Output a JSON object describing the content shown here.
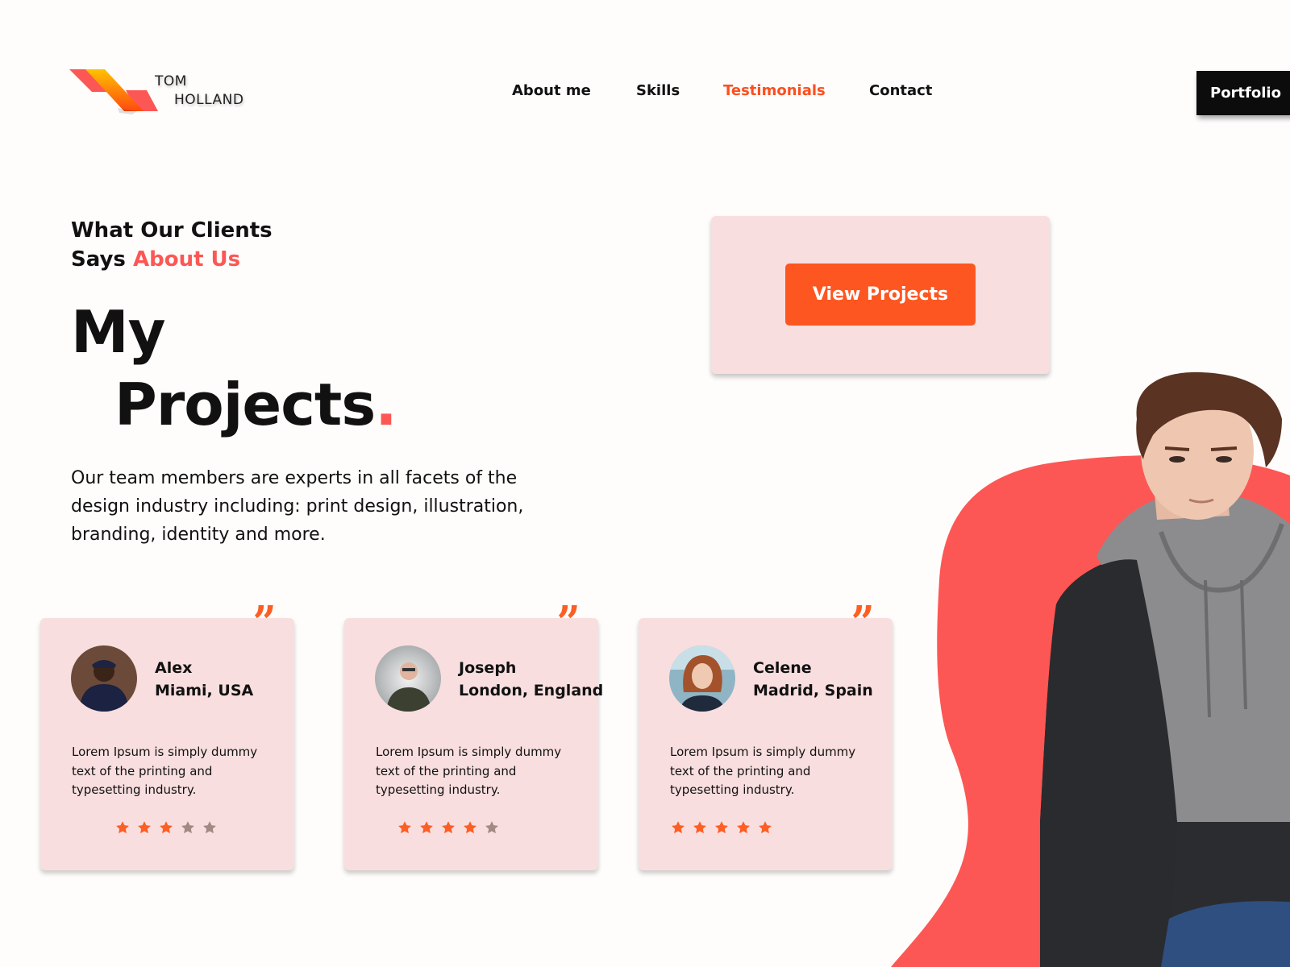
{
  "brand": {
    "line1": "TOM",
    "line2": "HOLLAND",
    "colors": {
      "red": "#fc5754",
      "orange": "#fe5620",
      "yellow": "#ffb300"
    }
  },
  "nav": {
    "items": [
      {
        "label": "About me",
        "active": false
      },
      {
        "label": "Skills",
        "active": false
      },
      {
        "label": "Testimonials",
        "active": true
      },
      {
        "label": "Contact",
        "active": false
      }
    ],
    "active_color": "#fc4f1f",
    "portfolio_label": "Portfolio"
  },
  "hero": {
    "eyebrow_line1": "What Our Clients",
    "eyebrow_line2_plain": "Says",
    "eyebrow_line2_accent": "About Us",
    "title_line1": "My",
    "title_line2": "Projects",
    "title_dot": ".",
    "description": "Our team members are experts in all facets of the design industry including: print design, illustration, branding, identity and more."
  },
  "cta": {
    "label": "View Projects",
    "button_color": "#fe5620",
    "panel_color": "#f9dedf"
  },
  "testimonials": [
    {
      "name": "Alex",
      "location": "Miami, USA",
      "text": "Lorem Ipsum is simply dummy text of the printing and typesetting industry.",
      "rating": 3,
      "max_rating": 5,
      "avatar": "avatar-alex"
    },
    {
      "name": "Joseph",
      "location": "London, England",
      "text": "Lorem Ipsum is simply dummy text of the printing and typesetting industry.",
      "rating": 4,
      "max_rating": 5,
      "avatar": "avatar-joseph"
    },
    {
      "name": "Celene",
      "location": "Madrid, Spain",
      "text": "Lorem Ipsum is simply dummy text of the printing and typesetting industry.",
      "rating": 5,
      "max_rating": 5,
      "avatar": "avatar-celene"
    }
  ],
  "quote_mark": "”",
  "star_colors": {
    "filled": "#fd5e23",
    "empty": "#a08a82"
  },
  "hero_image": "portrait-photo"
}
